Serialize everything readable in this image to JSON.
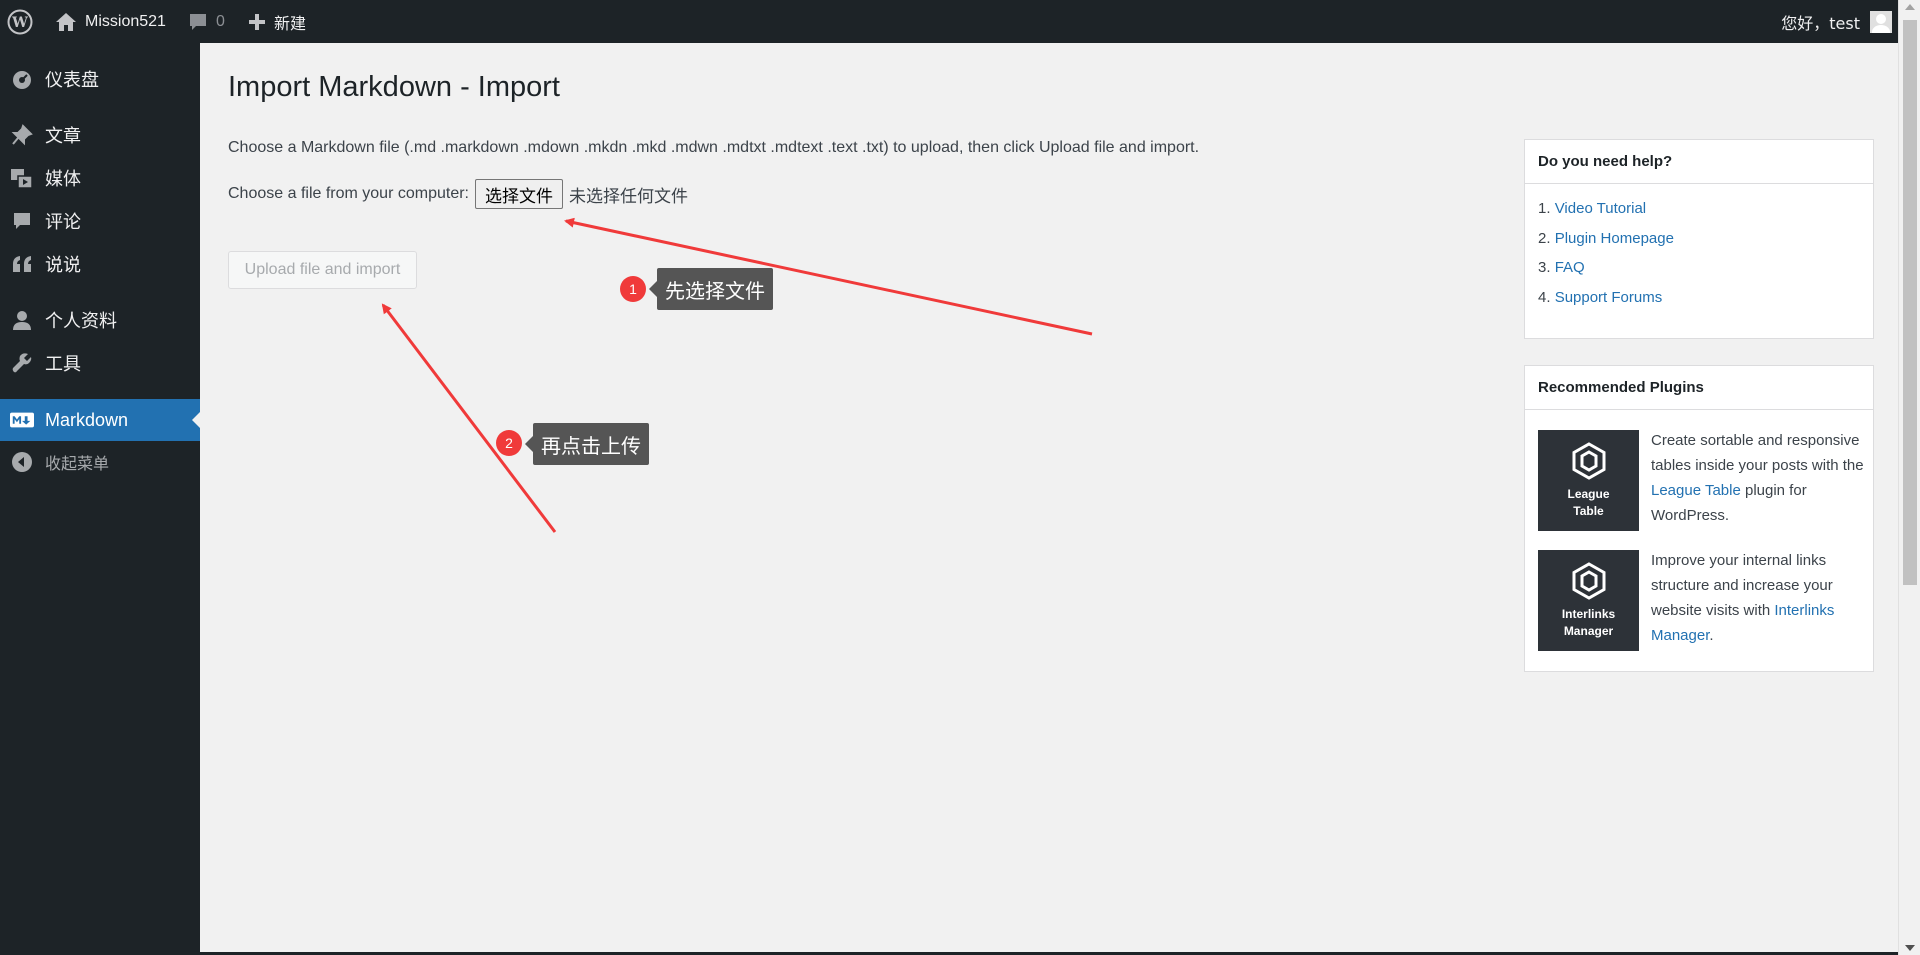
{
  "admin_bar": {
    "site_name": "Mission521",
    "comments_count": "0",
    "new_label": "新建",
    "greeting": "您好，test"
  },
  "sidebar": {
    "items": [
      {
        "label": "仪表盘",
        "icon": "dashboard-icon"
      },
      {
        "label": "文章",
        "icon": "pin-icon"
      },
      {
        "label": "媒体",
        "icon": "media-icon"
      },
      {
        "label": "评论",
        "icon": "comment-icon"
      },
      {
        "label": "说说",
        "icon": "quote-icon"
      },
      {
        "label": "个人资料",
        "icon": "user-icon"
      },
      {
        "label": "工具",
        "icon": "wrench-icon"
      },
      {
        "label": "Markdown",
        "icon": "markdown-icon"
      },
      {
        "label": "收起菜单",
        "icon": "collapse-icon"
      }
    ],
    "active": "Markdown"
  },
  "main": {
    "title": "Import Markdown - Import",
    "intro": "Choose a Markdown file (.md .markdown .mdown .mkdn .mkd .mdwn .mdtxt .mdtext .text .txt) to upload, then click Upload file and import.",
    "file_label": "Choose a file from your computer:",
    "choose_button": "选择文件",
    "no_file_text": "未选择任何文件",
    "upload_button": "Upload file and import"
  },
  "annotations": [
    {
      "number": "1",
      "text": "先选择文件"
    },
    {
      "number": "2",
      "text": "再点击上传"
    }
  ],
  "help_box": {
    "title": "Do you need help?",
    "links": [
      {
        "num": "1. ",
        "label": "Video Tutorial"
      },
      {
        "num": "2. ",
        "label": "Plugin Homepage"
      },
      {
        "num": "3. ",
        "label": "FAQ"
      },
      {
        "num": "4. ",
        "label": "Support Forums"
      }
    ]
  },
  "plugins_box": {
    "title": "Recommended Plugins",
    "plugins": [
      {
        "thumb_line1": "League",
        "thumb_line2": "Table",
        "desc_before": "Create sortable and responsive tables inside your posts with the ",
        "link": "League Table",
        "desc_after": " plugin for WordPress."
      },
      {
        "thumb_line1": "Interlinks",
        "thumb_line2": "Manager",
        "desc_before": "Improve your internal links structure and increase your website visits with ",
        "link": "Interlinks Manager",
        "desc_after": "."
      }
    ]
  },
  "colors": {
    "admin_bar": "#1d2327",
    "accent": "#2271b1",
    "annotation_red": "#f03a3a",
    "tooltip": "#555555"
  }
}
